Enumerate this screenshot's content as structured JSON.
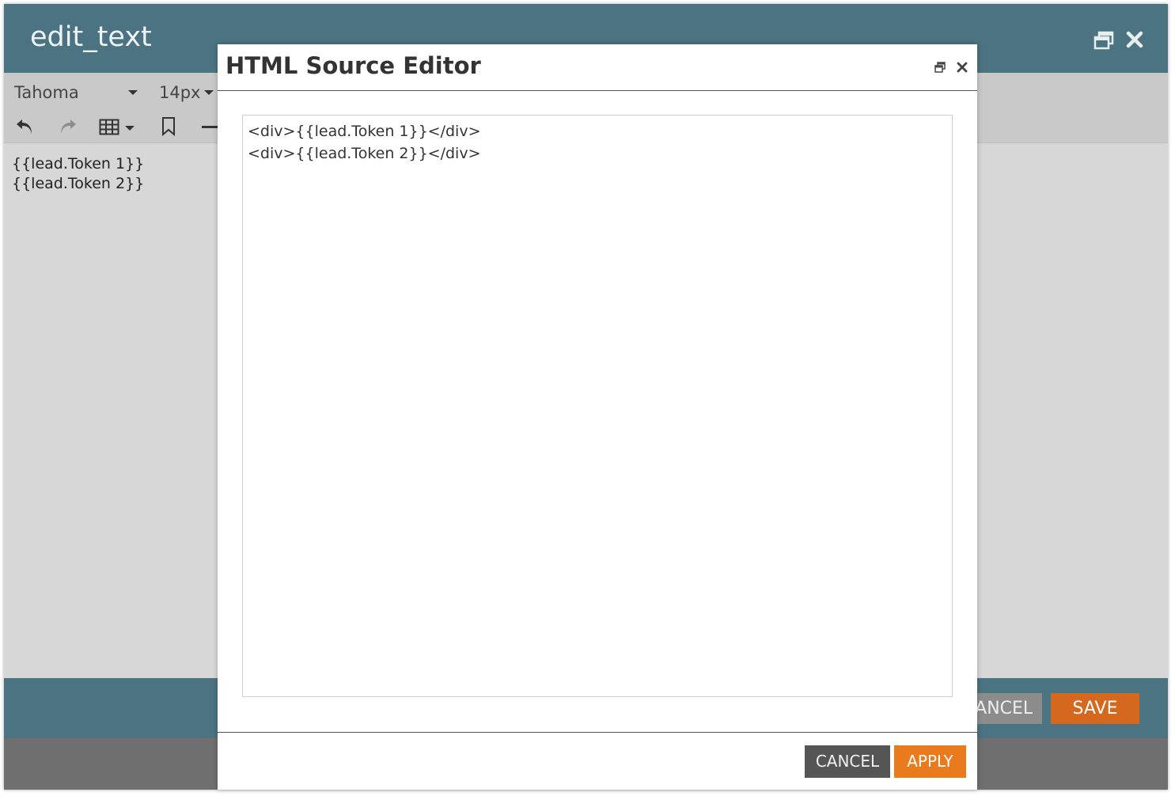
{
  "window": {
    "title": "edit_text",
    "header_color": "#4b7381"
  },
  "toolbar": {
    "font_family": "Tahoma",
    "font_size": "14px",
    "icons": [
      "undo-icon",
      "redo-icon",
      "table-icon",
      "bookmark-icon",
      "horizontal-rule-icon"
    ]
  },
  "editor": {
    "lines": [
      "{{lead.Token 1}}",
      "{{lead.Token 2}}"
    ]
  },
  "footer": {
    "cancel_label": "CANCEL",
    "save_label": "SAVE",
    "save_color": "#d4681e"
  },
  "dialog": {
    "title": "HTML Source Editor",
    "source": "<div>{{lead.Token 1}}</div>\n<div>{{lead.Token 2}}</div>",
    "cancel_label": "CANCEL",
    "apply_label": "APPLY",
    "apply_color": "#e97a1e"
  }
}
